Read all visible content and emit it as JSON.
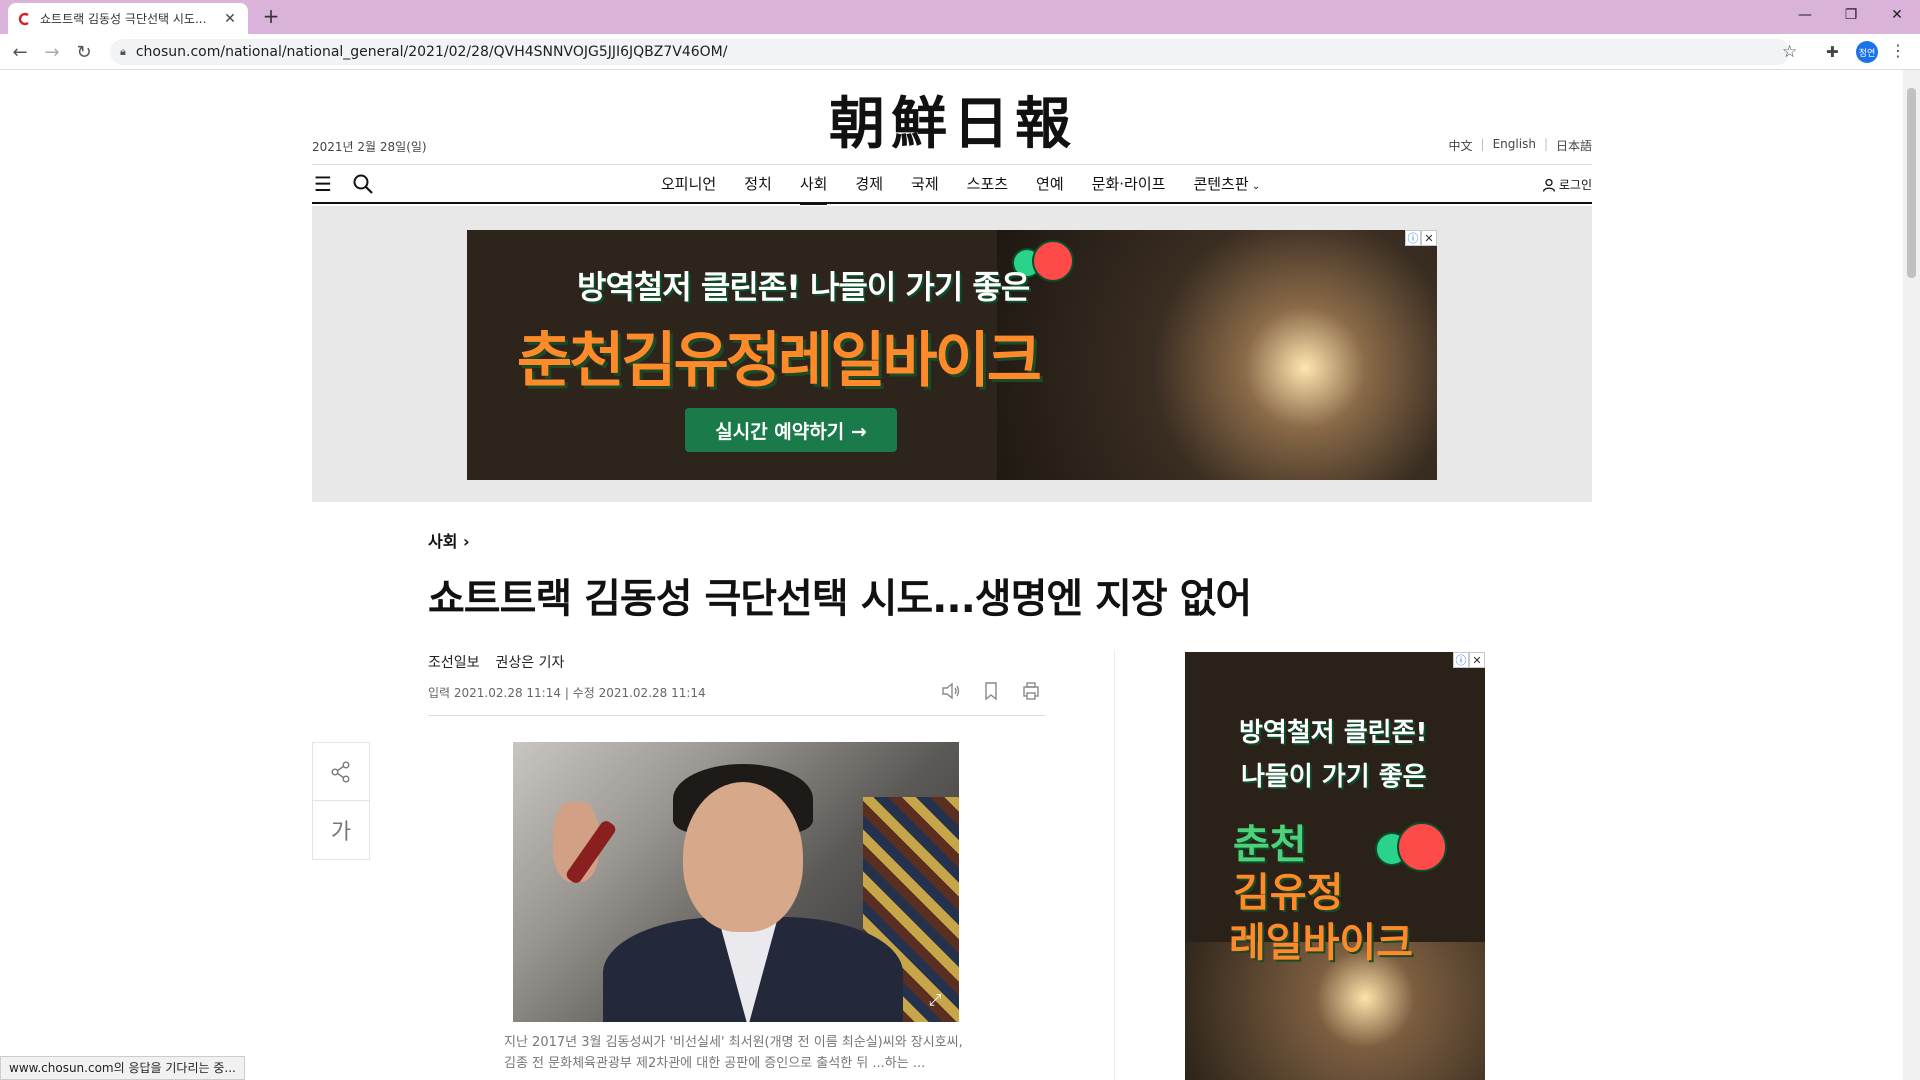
{
  "browser": {
    "tab_title": "쇼트트랙 김동성 극단선택 시도...",
    "url": "chosun.com/national/national_general/2021/02/28/QVH4SNNVOJG5JJI6JQBZ7V46OM/",
    "profile_label": "정연",
    "status_text": "www.chosun.com의 응답을 기다리는 중..."
  },
  "header": {
    "logo": "朝鮮日報",
    "date": "2021년 2월 28일(일)",
    "languages": [
      "中文",
      "English",
      "日本語"
    ],
    "login": "로그인"
  },
  "nav": {
    "items": [
      "오피니언",
      "정치",
      "사회",
      "경제",
      "국제",
      "스포츠",
      "연예",
      "문화·라이프",
      "콘텐츠판"
    ],
    "active": "사회"
  },
  "ad_top": {
    "line1": "방역철저 클린존! 나들이 가기 좋은",
    "line2": "춘천김유정레일바이크",
    "cta": "실시간 예약하기 →",
    "colors": {
      "green": "#1a7a4a",
      "orange": "#ff8a2a",
      "balloon_green": "#2bd38a",
      "balloon_red": "#ff4a4a"
    }
  },
  "article": {
    "section": "사회 ›",
    "headline": "쇼트트랙 김동성 극단선택 시도...생명엔 지장 없어",
    "publisher": "조선일보",
    "author": "권상은 기자",
    "dates": "입력 2021.02.28 11:14 | 수정 2021.02.28 11:14",
    "font_size_label": "가",
    "caption": "지난 2017년 3월 김동성씨가 '비선실세' 최서원(개명 전 이름 최순실)씨와 장시호씨, 김종 전 문화체육관광부 제2차관에 대한 공판에 증인으로 출석한 뒤 ...하는 ..."
  },
  "ad_side": {
    "line1": "방역철저 클린존!",
    "line2": "나들이 가기 좋은",
    "line3": "춘천",
    "line4": "김유정",
    "line5": "레일바이크"
  }
}
